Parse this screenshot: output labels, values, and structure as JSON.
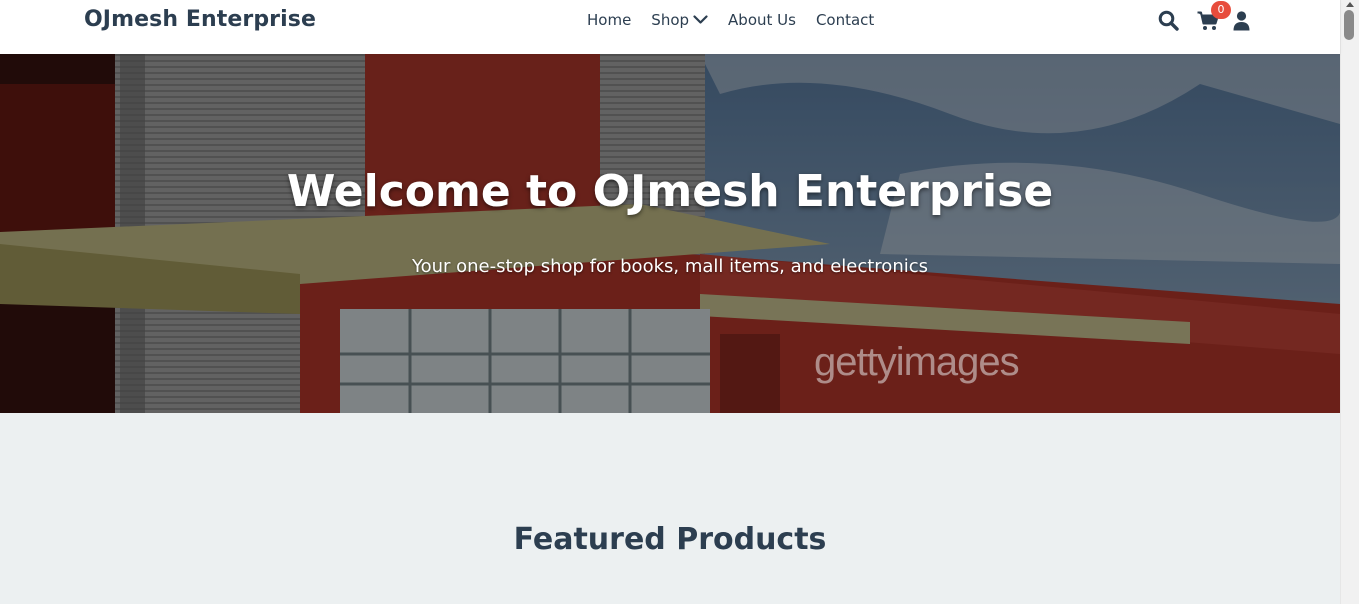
{
  "header": {
    "brand": "OJmesh Enterprise",
    "nav": [
      {
        "label": "Home"
      },
      {
        "label": "Shop"
      },
      {
        "label": "About Us"
      },
      {
        "label": "Contact"
      }
    ],
    "cart_count": "0"
  },
  "hero": {
    "title": "Welcome to OJmesh Enterprise",
    "subtitle": "Your one-stop shop for books, mall items, and electronics",
    "watermark": "gettyimages"
  },
  "featured": {
    "title": "Featured Products"
  },
  "icons": [
    "search-icon",
    "cart-icon",
    "user-icon",
    "chevron-down-icon"
  ],
  "colors": {
    "text_dark": "#2c3e50",
    "badge": "#e74c3c",
    "section_bg": "#ecf0f1",
    "header_bg": "#ffffff"
  }
}
